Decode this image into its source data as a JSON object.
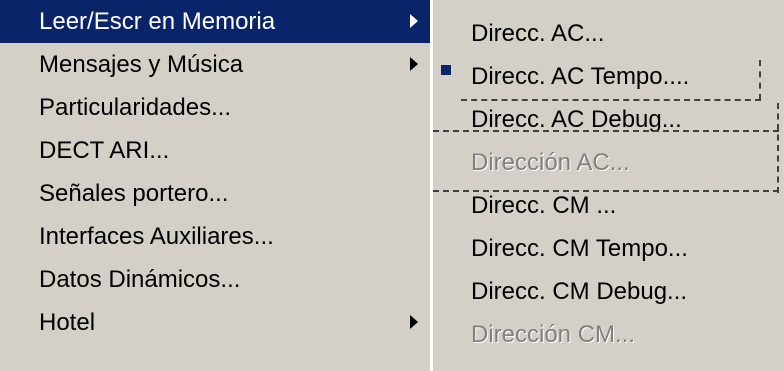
{
  "main_menu": {
    "items": [
      {
        "label": "Leer/Escr en Memoria",
        "has_submenu": true,
        "highlighted": true
      },
      {
        "label": "Mensajes y Música",
        "has_submenu": true
      },
      {
        "label": "Particularidades..."
      },
      {
        "label": "DECT ARI..."
      },
      {
        "label": "Señales portero..."
      },
      {
        "label": "Interfaces Auxiliares..."
      },
      {
        "label": "Datos Dinámicos..."
      },
      {
        "label": "Hotel",
        "has_submenu": true
      }
    ]
  },
  "sub_menu": {
    "items": [
      {
        "label": "Direcc. AC..."
      },
      {
        "label": "Direcc. AC Tempo....",
        "checked": true
      },
      {
        "label": "Direcc. AC Debug..."
      },
      {
        "label": "Dirección AC...",
        "disabled": true
      },
      {
        "label": "Direcc. CM ..."
      },
      {
        "label": "Direcc. CM Tempo..."
      },
      {
        "label": "Direcc. CM Debug..."
      },
      {
        "label": "Dirección CM...",
        "disabled": true
      }
    ]
  },
  "colors": {
    "menu_background": "#d4d0c8",
    "highlight": "#0a246a",
    "disabled_text": "#808080"
  },
  "icons": {
    "submenu_arrow": "triangle-right",
    "check_mark": "square-bullet"
  }
}
